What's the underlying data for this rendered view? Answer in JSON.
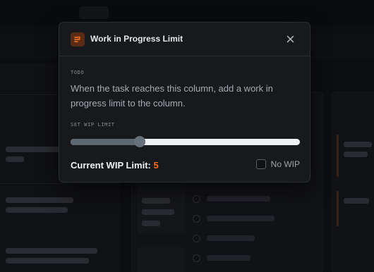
{
  "modal": {
    "title": "Work in Progress Limit",
    "section_label": "TODO",
    "description": "When the task reaches this column, add a work in progress limit to the column.",
    "slider_label": "SET WIP LIMIT",
    "slider_fraction": 0.3,
    "current_label": "Current WIP Limit: ",
    "current_value": "5",
    "no_wip_label": "No WIP",
    "no_wip_checked": false
  },
  "colors": {
    "accent": "#ff6b1a",
    "icon_bg": "#5a2c16",
    "modal_bg": "#17191d"
  }
}
